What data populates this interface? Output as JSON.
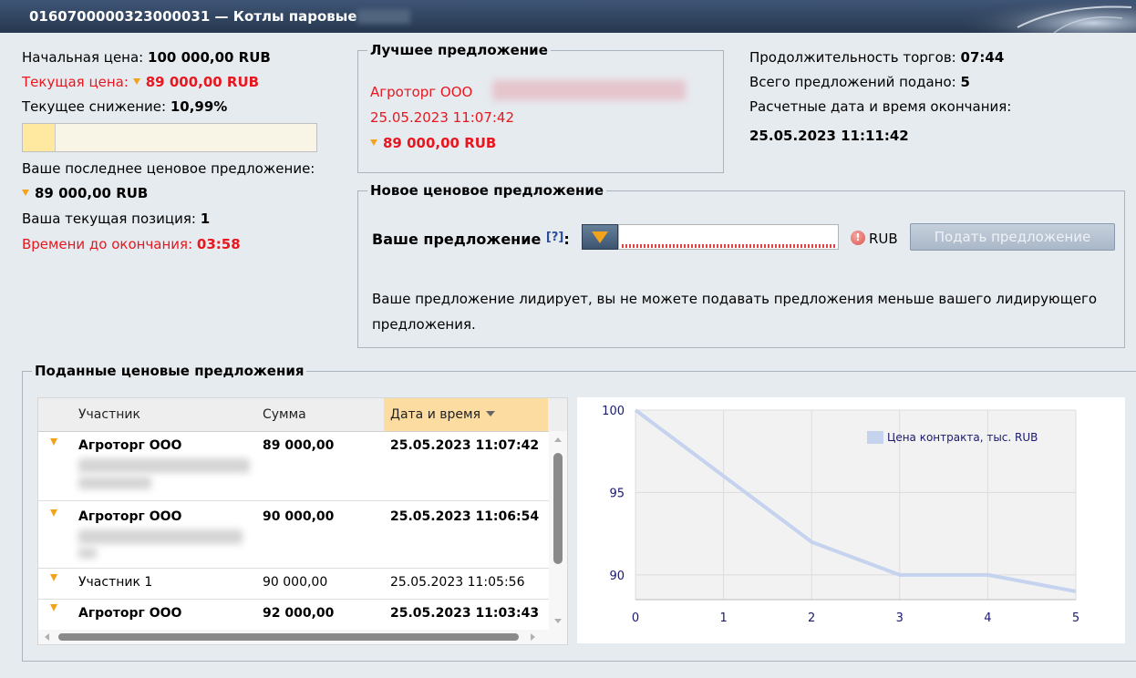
{
  "window": {
    "title": "0160700000323000031 — Котлы паровые"
  },
  "summary": {
    "start_price_label": "Начальная цена:",
    "start_price_value": "100 000,00 RUB",
    "current_price_label": "Текущая цена:",
    "current_price_value": "89 000,00 RUB",
    "current_decrease_label": "Текущее снижение:",
    "current_decrease_value": "10,99%",
    "decrease_progress": 0.11,
    "last_offer_label": "Ваше последнее ценовое предложение:",
    "last_offer_value": "89 000,00 RUB",
    "position_label": "Ваша текущая позиция:",
    "position_value": "1",
    "time_left_label": "Времени до окончания:",
    "time_left_value": "03:58"
  },
  "best_offer": {
    "legend": "Лучшее предложение",
    "company": "Агроторг ООО",
    "datetime": "25.05.2023 11:07:42",
    "price": "89 000,00 RUB"
  },
  "stats": {
    "duration_label": "Продолжительность торгов:",
    "duration_value": "07:44",
    "total_offers_label": "Всего предложений подано:",
    "total_offers_value": "5",
    "end_label": "Расчетные дата и время окончания:",
    "end_value": "25.05.2023 11:11:42"
  },
  "new_offer": {
    "legend": "Новое ценовое предложение",
    "label": "Ваше предложение",
    "help": "[?]",
    "colon": ":",
    "input_value": "",
    "currency": "RUB",
    "submit_label": "Подать предложение",
    "notice": "Ваше предложение лидирует, вы не можете подавать предложения меньше вашего лидирующего предложения."
  },
  "offers_table": {
    "legend": "Поданные ценовые предложения",
    "columns": [
      "Участник",
      "Сумма",
      "Дата и время"
    ],
    "rows": [
      {
        "participant": "Агроторг ООО",
        "amount": "89 000,00",
        "datetime": "25.05.2023 11:07:42"
      },
      {
        "participant": "Агроторг ООО",
        "amount": "90 000,00",
        "datetime": "25.05.2023 11:06:54"
      },
      {
        "participant": "Участник 1",
        "amount": "90 000,00",
        "datetime": "25.05.2023 11:05:56"
      },
      {
        "participant": "Агроторг ООО",
        "amount": "92 000,00",
        "datetime": "25.05.2023 11:03:43"
      }
    ]
  },
  "chart_data": {
    "type": "line",
    "x": [
      0,
      1,
      2,
      3,
      4,
      5
    ],
    "series": [
      {
        "name": "Цена контракта, тыс. RUB",
        "values": [
          100,
          96,
          92,
          90,
          90,
          89
        ],
        "color": "#c5d3ef"
      }
    ],
    "xticks": [
      "0",
      "1",
      "2",
      "3",
      "4",
      "5"
    ],
    "yticks": [
      "90",
      "95",
      "100"
    ],
    "xlim": [
      0,
      5
    ],
    "ylim": [
      88.5,
      100
    ],
    "grid": true,
    "legend": "top-right"
  },
  "colors": {
    "accent_red": "#e8171f",
    "triangle": "#f2a31b",
    "titlebar": "#334763",
    "sorted_header": "#fcdca0"
  }
}
